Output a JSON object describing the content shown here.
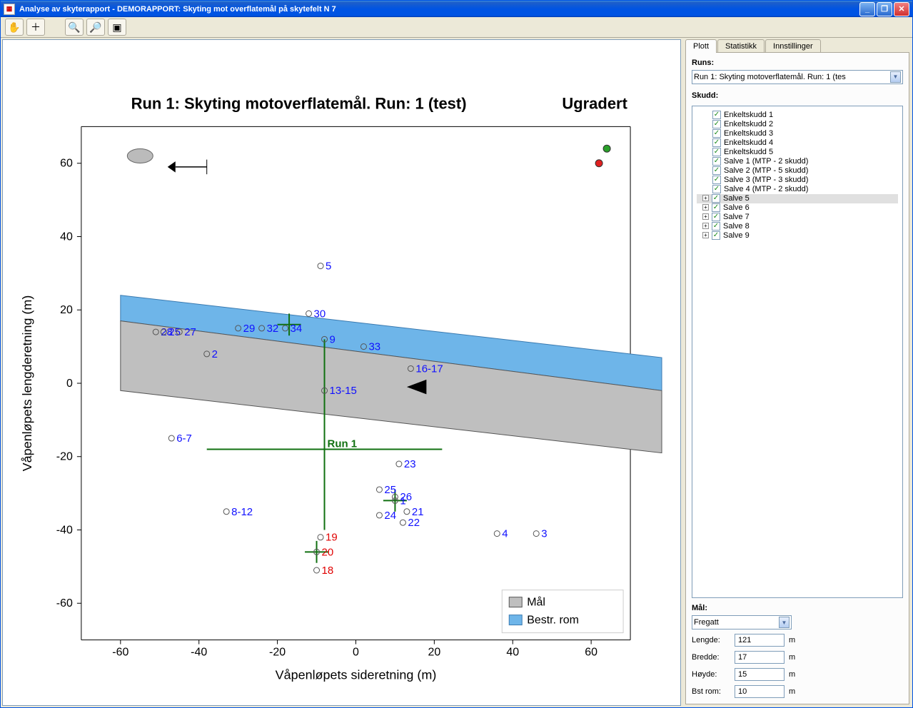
{
  "window": {
    "title": "Analyse av skyterapport - DEMORAPPORT: Skyting mot overflatemål på skytefelt N 7"
  },
  "side": {
    "tabs": [
      "Plott",
      "Statistikk",
      "Innstillinger"
    ],
    "runs_label": "Runs:",
    "runs_selected": "Run 1: Skyting motoverflatemål. Run: 1 (tes",
    "skudd_label": "Skudd:",
    "tree": [
      {
        "label": "Enkeltskudd 1",
        "exp": false
      },
      {
        "label": "Enkeltskudd 2",
        "exp": false
      },
      {
        "label": "Enkeltskudd 3",
        "exp": false
      },
      {
        "label": "Enkeltskudd 4",
        "exp": false
      },
      {
        "label": "Enkeltskudd 5",
        "exp": false
      },
      {
        "label": "Salve 1 (MTP - 2 skudd)",
        "exp": false
      },
      {
        "label": "Salve 2 (MTP - 5 skudd)",
        "exp": false
      },
      {
        "label": "Salve 3 (MTP - 3 skudd)",
        "exp": false
      },
      {
        "label": "Salve 4 (MTP - 2 skudd)",
        "exp": false
      },
      {
        "label": "Salve 5",
        "exp": true,
        "selected": true
      },
      {
        "label": "Salve 6",
        "exp": true
      },
      {
        "label": "Salve 7",
        "exp": true
      },
      {
        "label": "Salve 8",
        "exp": true
      },
      {
        "label": "Salve 9",
        "exp": true
      }
    ],
    "maal_label": "Mål:",
    "maal_selected": "Fregatt",
    "lengde_label": "Lengde:",
    "lengde_value": "121",
    "bredde_label": "Bredde:",
    "bredde_value": "17",
    "hoyde_label": "Høyde:",
    "hoyde_value": "15",
    "bstrom_label": "Bst rom:",
    "bstrom_value": "10",
    "unit": "m"
  },
  "chart_data": {
    "type": "scatter",
    "title": "Run 1: Skyting motoverflatemål. Run: 1 (test)",
    "classification": "Ugradert",
    "xlabel": "Våpenløpets sideretning (m)",
    "ylabel": "Våpenløpets lengderetning (m)",
    "xlim": [
      -70,
      70
    ],
    "ylim": [
      -70,
      70
    ],
    "xticks": [
      -60,
      -40,
      -20,
      0,
      20,
      40,
      60
    ],
    "yticks": [
      -60,
      -40,
      -20,
      0,
      20,
      40,
      60
    ],
    "legend": [
      {
        "label": "Mål",
        "color": "#bfbfbf"
      },
      {
        "label": "Bestr. rom",
        "color": "#6eb5e9"
      }
    ],
    "run_marker": {
      "x": -8,
      "y": -18,
      "label": "Run 1"
    },
    "target_polygon": [
      [
        -60,
        17
      ],
      [
        78,
        -2
      ],
      [
        78,
        -19
      ],
      [
        -60,
        -2
      ]
    ],
    "bestr_polygon": [
      [
        -60,
        24
      ],
      [
        78,
        7
      ],
      [
        78,
        -2
      ],
      [
        -60,
        17
      ]
    ],
    "points": [
      {
        "x": -51,
        "y": 14,
        "label": "28"
      },
      {
        "x": -49,
        "y": 14,
        "label": "25"
      },
      {
        "x": -45,
        "y": 14,
        "label": "27"
      },
      {
        "x": -47,
        "y": -15,
        "label": "6-7"
      },
      {
        "x": -38,
        "y": 8,
        "label": "2"
      },
      {
        "x": -33,
        "y": -35,
        "label": "8-12"
      },
      {
        "x": -30,
        "y": 15,
        "label": "29"
      },
      {
        "x": -24,
        "y": 15,
        "label": "32"
      },
      {
        "x": -18,
        "y": 15,
        "label": "34"
      },
      {
        "x": -12,
        "y": 19,
        "label": "30"
      },
      {
        "x": -9,
        "y": 32,
        "label": "5"
      },
      {
        "x": -8,
        "y": -2,
        "label": "13-15"
      },
      {
        "x": -8,
        "y": 12,
        "label": "9"
      },
      {
        "x": -10,
        "y": -46,
        "label": "20",
        "red": true
      },
      {
        "x": -9,
        "y": -42,
        "label": "19",
        "red": true
      },
      {
        "x": -10,
        "y": -51,
        "label": "18",
        "red": true
      },
      {
        "x": 2,
        "y": 10,
        "label": "33"
      },
      {
        "x": 6,
        "y": -29,
        "label": "25"
      },
      {
        "x": 6,
        "y": -36,
        "label": "24"
      },
      {
        "x": 10,
        "y": -31,
        "label": "26"
      },
      {
        "x": 10,
        "y": -32,
        "label": "1"
      },
      {
        "x": 11,
        "y": -22,
        "label": "23"
      },
      {
        "x": 13,
        "y": -35,
        "label": "21"
      },
      {
        "x": 12,
        "y": -38,
        "label": "22"
      },
      {
        "x": 14,
        "y": 4,
        "label": "16-17"
      },
      {
        "x": 36,
        "y": -41,
        "label": "4"
      },
      {
        "x": 46,
        "y": -41,
        "label": "3"
      }
    ],
    "corner_markers": [
      {
        "x": 64,
        "y": 64,
        "color": "#2aa02a"
      },
      {
        "x": 62,
        "y": 60,
        "color": "#e02020"
      }
    ]
  }
}
